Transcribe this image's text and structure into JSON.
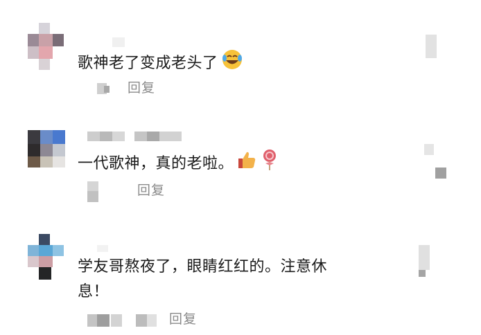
{
  "comments": [
    {
      "text": "歌神老了变成老头了",
      "emoji": [
        "laughing-tears-emoji"
      ],
      "reply_label": "回复"
    },
    {
      "text": "一代歌神，真的老啦。",
      "emoji": [
        "thumbs-up-emoji",
        "lollipop-emoji"
      ],
      "reply_label": "回复"
    },
    {
      "text_line1": "学友哥熬夜了，眼睛红红的。注意休",
      "text_line2": "息！",
      "reply_label": "回复"
    }
  ],
  "colors": {
    "text": "#1a1a1a",
    "reply": "#8a8a8a",
    "blur_gray": "#c8c8c8"
  }
}
